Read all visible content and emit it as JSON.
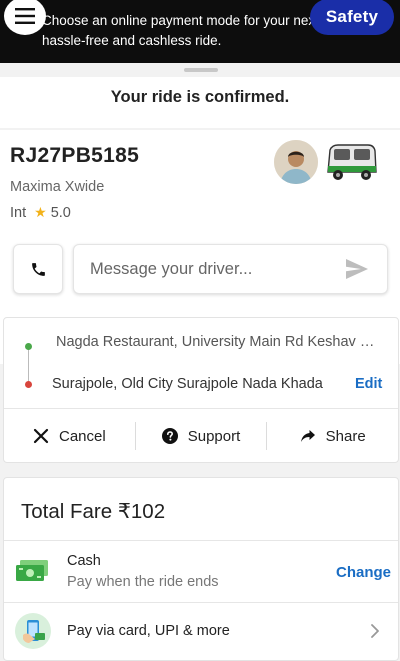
{
  "banner": {
    "line1": "Choose an online payment mode for your next ri",
    "line2": "hassle-free and cashless ride.",
    "safety_label": "Safety"
  },
  "status": {
    "title": "Your ride is confirmed."
  },
  "driver": {
    "plate": "RJ27PB5185",
    "vehicle": "Maxima Xwide",
    "rating_prefix": "Int",
    "rating": "5.0",
    "message_placeholder": "Message your driver..."
  },
  "route": {
    "pickup": "Nagda Restaurant, University Main Rd Keshav Nagar",
    "drop": "Surajpole, Old City Surajpole Nada Khada",
    "edit_label": "Edit",
    "actions": [
      {
        "label": "Cancel",
        "icon": "close-icon"
      },
      {
        "label": "Support",
        "icon": "help-icon"
      },
      {
        "label": "Share",
        "icon": "share-icon"
      }
    ]
  },
  "fare": {
    "title": "Total Fare ₹102",
    "cash_label": "Cash",
    "cash_sub": "Pay when the ride ends",
    "change_label": "Change",
    "upi_label": "Pay via card, UPI & more"
  },
  "colors": {
    "accent": "#1a6dc4",
    "safety": "#1a2ea8",
    "topbar": "#0d0d0d"
  }
}
